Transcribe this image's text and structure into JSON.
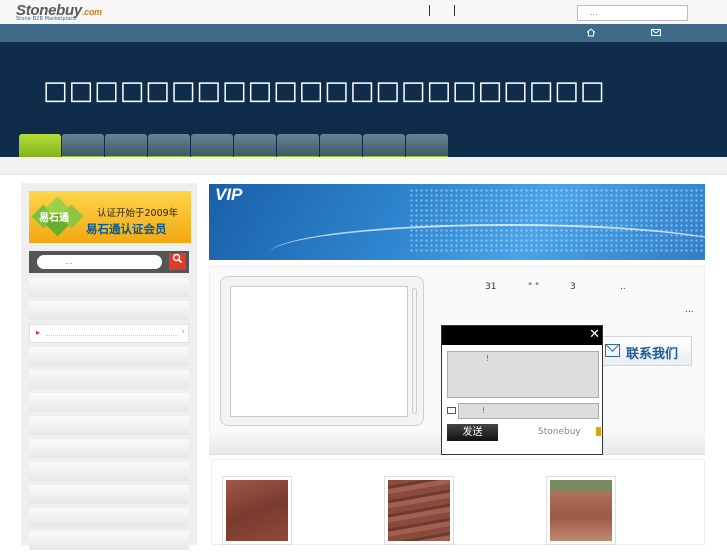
{
  "header": {
    "logo_brand": "Stonebuy",
    "logo_suffix": ".com",
    "logo_tagline": "Stone B2B Marketplace",
    "search_placeholder": "..."
  },
  "icons": {
    "home": "home-icon",
    "mail": "mail-icon"
  },
  "banner": {
    "title": "□□□□□□□□□□□□□□□□□□□□□□"
  },
  "nav": {
    "tab_count_visible": 10
  },
  "sidebar": {
    "badge_logo": "易石通",
    "badge_line1": "认证开始于2009年",
    "badge_line2": "易石通认证会员",
    "search_placeholder": "...",
    "search_button": "Q",
    "items": [
      "",
      "",
      "",
      "",
      "",
      "",
      "",
      "",
      "",
      "",
      "",
      ""
    ]
  },
  "vip_banner": {
    "label": "VIP"
  },
  "info": {
    "n1": "31",
    "q": "\"  \"",
    "n2": "3",
    "dots1": "..",
    "dots2": "..."
  },
  "contact_button": {
    "label": "联系我们"
  },
  "popup": {
    "message_placeholder": "!",
    "email_placeholder": "!",
    "send_label": "发送",
    "brand": "Stonebuy"
  },
  "colors": {
    "banner_bg": "#0f2d4b",
    "strip_bg": "#3f6a88",
    "nav_active": "#9ac528",
    "vip_blue": "#2f86d0",
    "contact_text": "#1f5b9a"
  }
}
